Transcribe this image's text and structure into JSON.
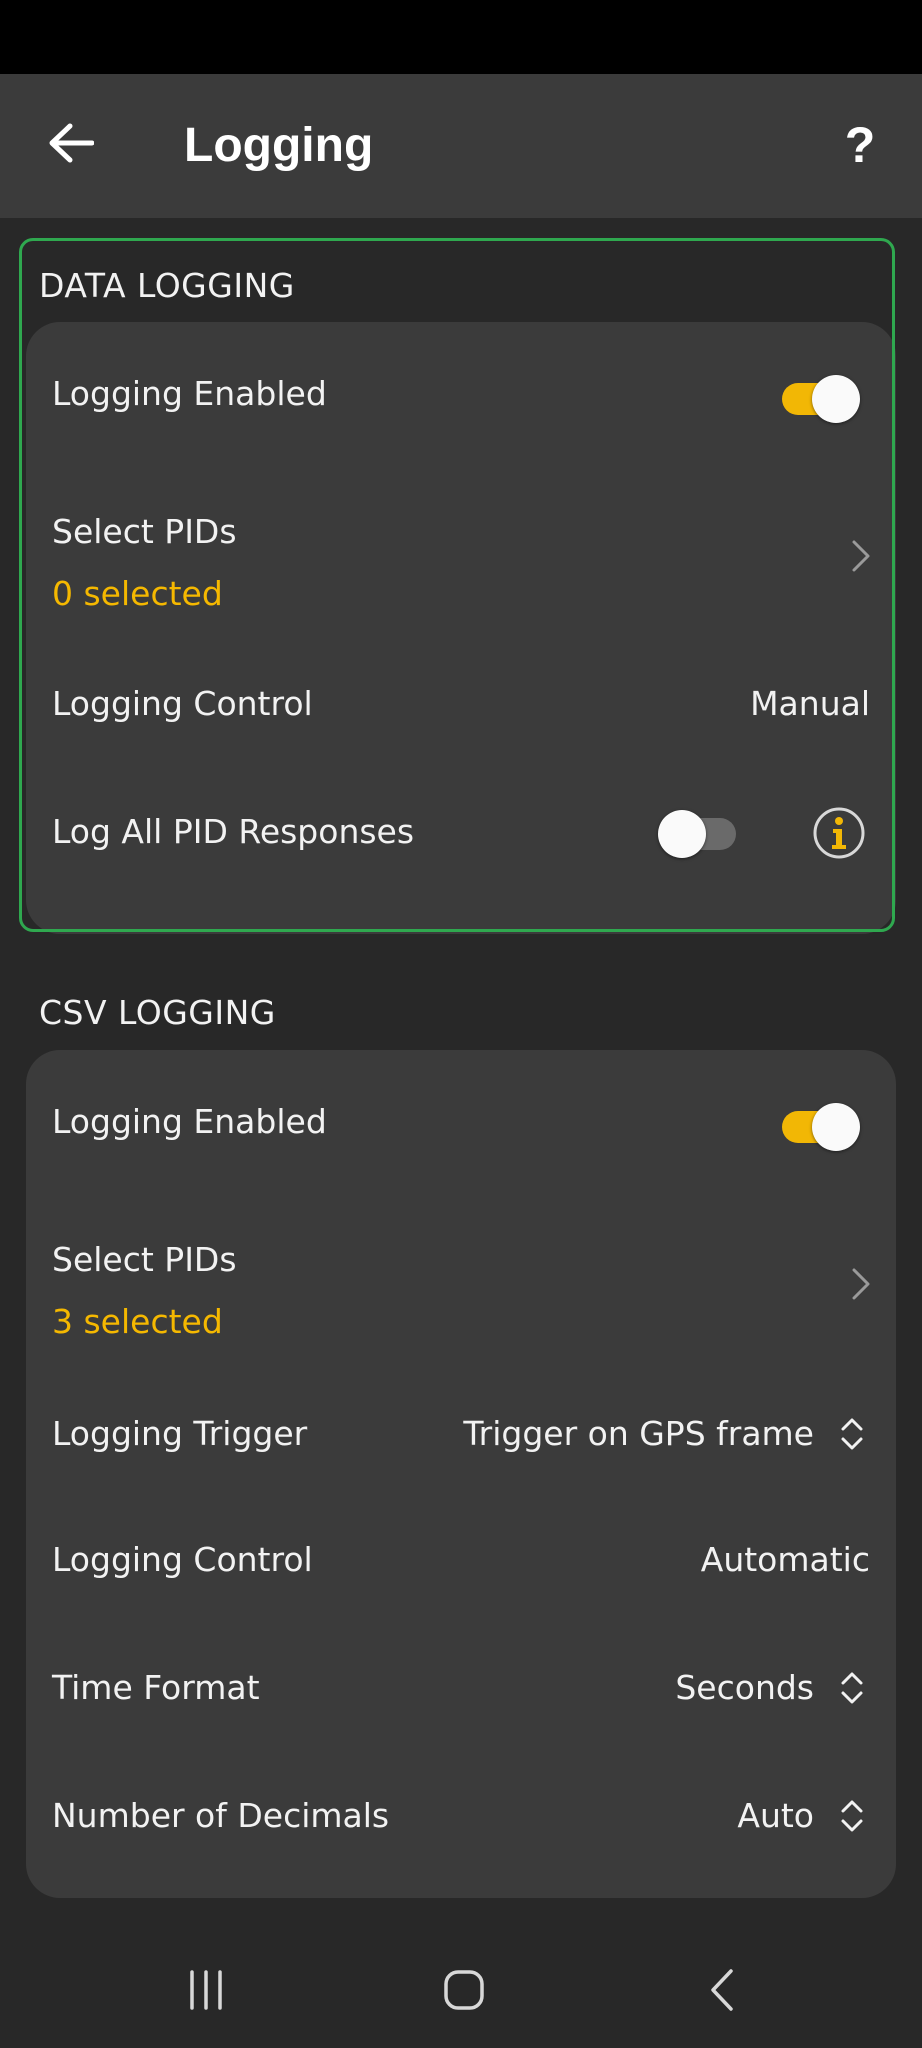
{
  "app_bar": {
    "title": "Logging",
    "back_icon": "arrow-left-icon",
    "help_label": "?"
  },
  "data_logging": {
    "header": "DATA LOGGING",
    "logging_enabled": {
      "label": "Logging Enabled",
      "on": true
    },
    "select_pids": {
      "label": "Select PIDs",
      "sub": "0 selected"
    },
    "logging_control": {
      "label": "Logging Control",
      "value": "Manual"
    },
    "log_all_pid_responses": {
      "label": "Log All PID Responses",
      "on": false,
      "info_icon": "info-icon"
    }
  },
  "csv_logging": {
    "header": "CSV LOGGING",
    "logging_enabled": {
      "label": "Logging Enabled",
      "on": true
    },
    "select_pids": {
      "label": "Select PIDs",
      "sub": "3 selected"
    },
    "logging_trigger": {
      "label": "Logging Trigger",
      "value": "Trigger on GPS frame"
    },
    "logging_control": {
      "label": "Logging Control",
      "value": "Automatic"
    },
    "time_format": {
      "label": "Time Format",
      "value": "Seconds"
    },
    "number_of_decimals": {
      "label": "Number of Decimals",
      "value": "Auto"
    }
  },
  "colors": {
    "accent": "#f2b705",
    "selected_text": "#f5b800",
    "highlight_border": "#2fa84f",
    "card": "#3b3b3b",
    "background": "#282828"
  },
  "nav_bar": {
    "recents_icon": "recent-apps-icon",
    "home_icon": "home-icon",
    "back_icon": "back-icon"
  }
}
